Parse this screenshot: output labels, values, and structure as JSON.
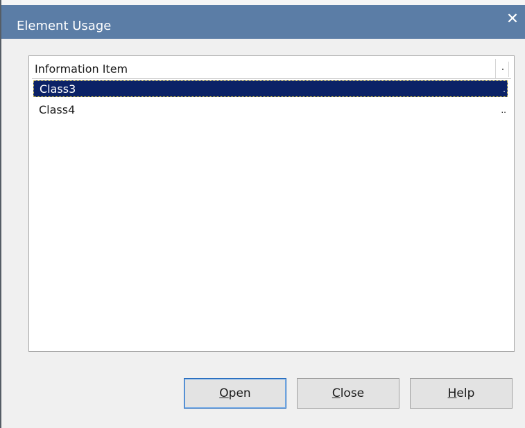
{
  "window": {
    "title": "Element Usage",
    "close_glyph": "✕"
  },
  "list": {
    "columns": [
      "Information Item",
      "."
    ],
    "rows": [
      {
        "label": "Class3",
        "trail": ".",
        "selected": true
      },
      {
        "label": "Class4",
        "trail": "..",
        "selected": false
      }
    ]
  },
  "buttons": [
    {
      "accel": "O",
      "rest": "pen"
    },
    {
      "accel": "C",
      "rest": "lose"
    },
    {
      "accel": "H",
      "rest": "elp"
    }
  ],
  "colors": {
    "titlebar": "#5b7da6",
    "selection": "#0b2266"
  }
}
